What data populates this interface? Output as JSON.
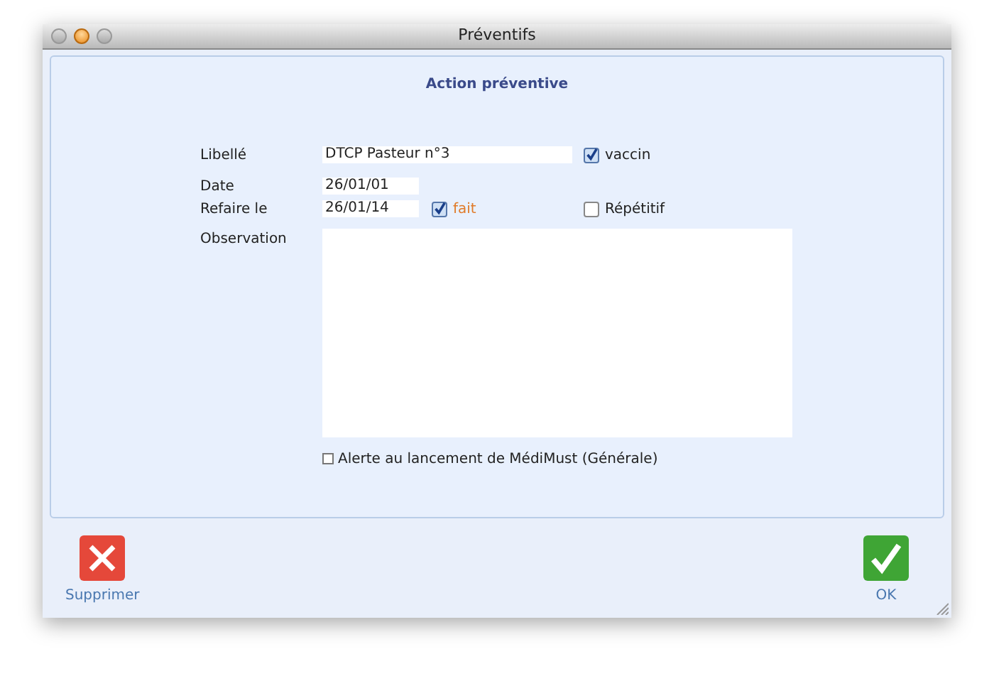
{
  "window": {
    "title": "Préventifs"
  },
  "panel": {
    "heading": "Action préventive"
  },
  "libelle": {
    "label": "Libellé",
    "value": "DTCP Pasteur n°3"
  },
  "vaccin": {
    "label": "vaccin",
    "checked": true
  },
  "date": {
    "label": "Date",
    "value": "26/01/01"
  },
  "refaire": {
    "label": "Refaire le",
    "value": "26/01/14"
  },
  "fait": {
    "label": "fait",
    "checked": true
  },
  "repetitif": {
    "label": "Répétitif",
    "checked": false
  },
  "observation": {
    "label": "Observation"
  },
  "alerte": {
    "label": "Alerte au lancement de MédiMust (Générale)",
    "checked": false
  },
  "buttons": [
    {
      "kind": "delete",
      "label": "Supprimer"
    },
    {
      "kind": "ok",
      "label": "OK"
    }
  ]
}
